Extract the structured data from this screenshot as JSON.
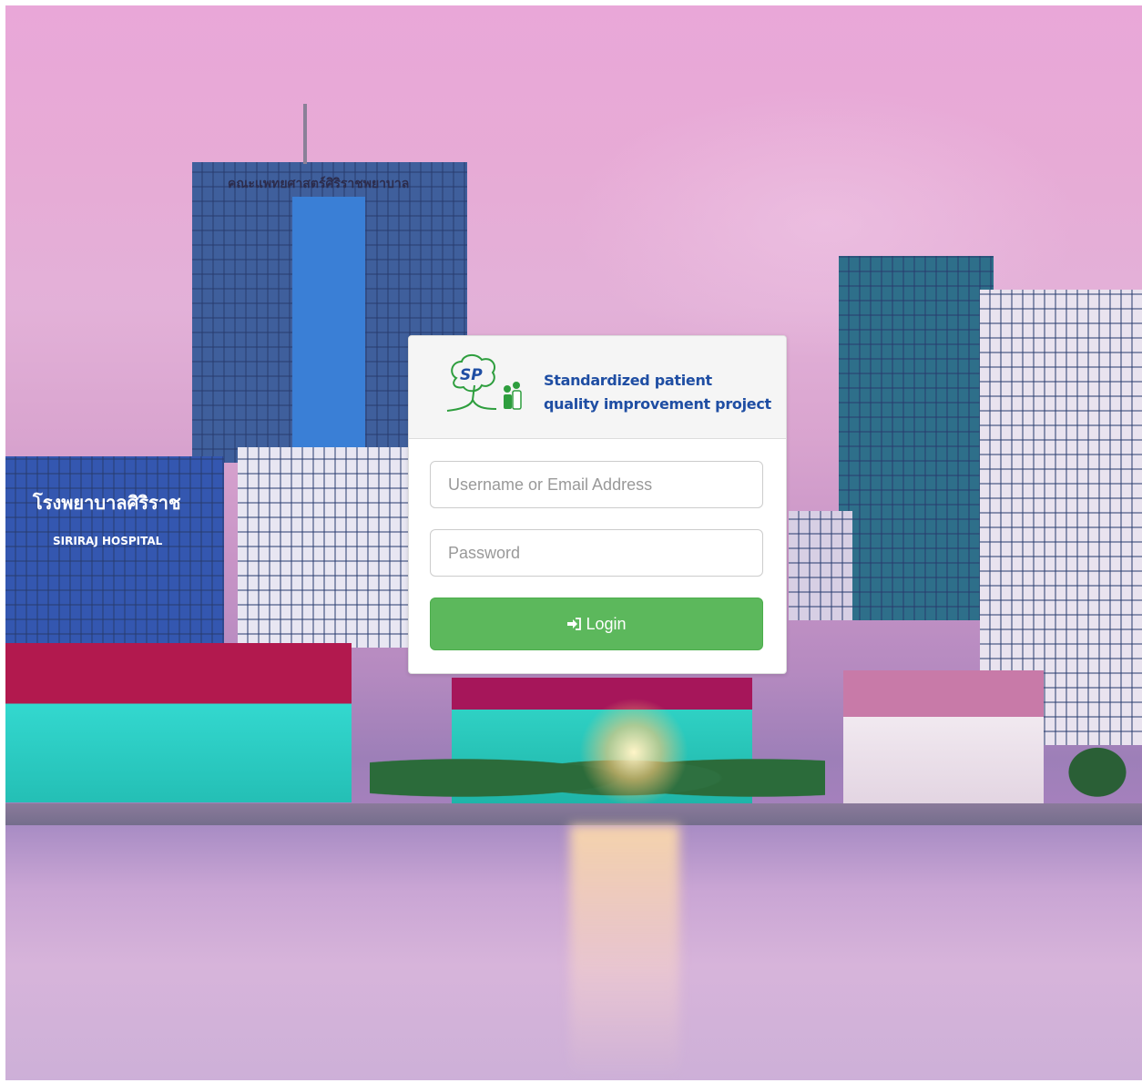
{
  "logo": {
    "mark_text": "SP",
    "line1": "Standardized patient",
    "line2": "quality improvement project",
    "text_color": "#1f4ea3",
    "icon": "sp-tree-logo-icon"
  },
  "form": {
    "username_placeholder": "Username or Email Address",
    "password_placeholder": "Password",
    "login_label": "Login",
    "login_icon": "sign-in-icon",
    "button_color": "#5cb85c"
  },
  "background": {
    "thai_sign_top": "คณะแพทยศาสตร์ศิริราชพยาบาล",
    "thai_sign_hospital": "โรงพยาบาลศิริราช",
    "hospital_sign": "SIRIRAJ HOSPITAL"
  }
}
